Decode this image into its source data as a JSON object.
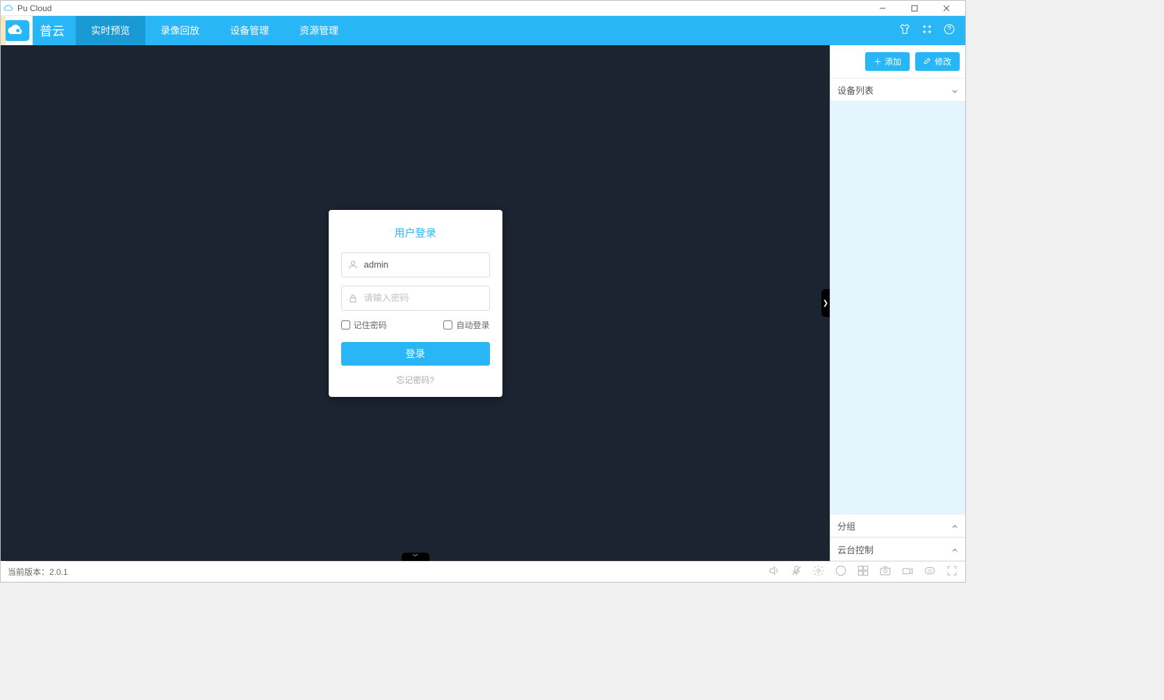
{
  "window": {
    "title": "Pu Cloud"
  },
  "brand": "普云",
  "nav": {
    "items": [
      {
        "label": "实时预览",
        "active": true
      },
      {
        "label": "录像回放",
        "active": false
      },
      {
        "label": "设备管理",
        "active": false
      },
      {
        "label": "资源管理",
        "active": false
      }
    ]
  },
  "login": {
    "title": "用户登录",
    "username_value": "admin",
    "password_placeholder": "请输入密码",
    "remember_label": "记住密码",
    "auto_label": "自动登录",
    "submit_label": "登录",
    "forgot_label": "忘记密码?"
  },
  "right": {
    "add_label": "添加",
    "edit_label": "修改",
    "device_list_header": "设备列表",
    "group_header": "分组",
    "ptz_header": "云台控制"
  },
  "status": {
    "version_label": "当前版本：",
    "version_value": "2.0.1"
  }
}
